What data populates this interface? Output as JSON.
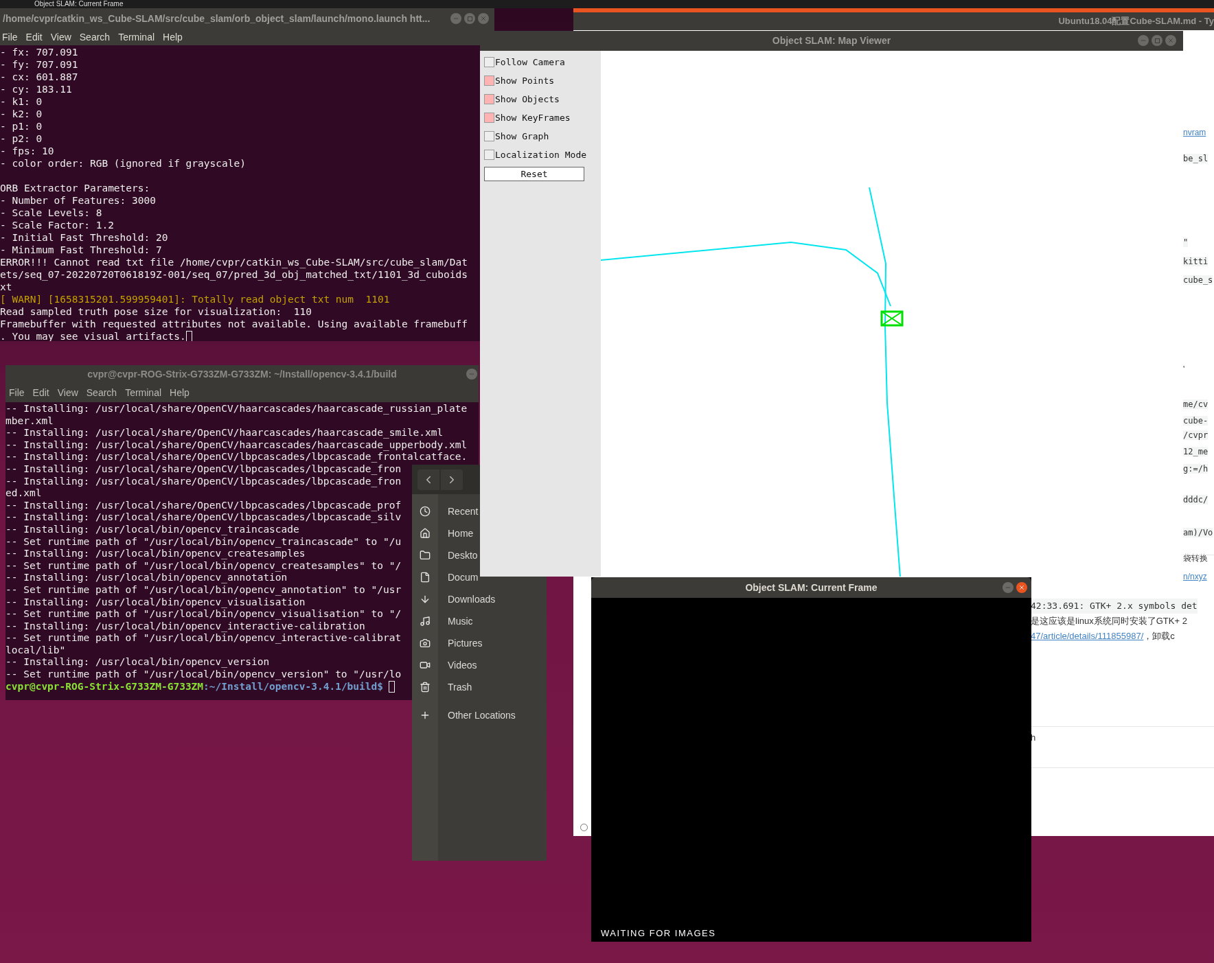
{
  "top_panel": {
    "title": "Object SLAM: Current Frame"
  },
  "browser": {
    "title": "Ubuntu18.04配置Cube-SLAM.md - Ty",
    "side_fragments": [
      {
        "text": "nvram",
        "kind": "link"
      },
      {
        "text": "be_sl",
        "kind": "code"
      },
      {
        "text": "\"",
        "kind": "code"
      },
      {
        "text": "kitti",
        "kind": "code"
      },
      {
        "text": "cube_s",
        "kind": "code"
      },
      {
        "text": "'",
        "kind": "text"
      },
      {
        "text": "me/cv",
        "kind": "code"
      },
      {
        "text": "cube-",
        "kind": "code"
      },
      {
        "text": "/cvpr",
        "kind": "code"
      },
      {
        "text": "12_me",
        "kind": "code"
      },
      {
        "text": "g:=/h",
        "kind": "code"
      },
      {
        "text": "dddc/",
        "kind": "code"
      },
      {
        "text": "am)/Vo",
        "kind": "code"
      },
      {
        "text": "袋转换",
        "kind": "text"
      },
      {
        "text": "n/nxyz",
        "kind": "link"
      }
    ],
    "lower_fragments": [
      {
        "text": "42:33.691: GTK+ 2.x symbols det",
        "kind": "code"
      },
      {
        "text": "是这应该是linux系统同时安装了GTK+ 2",
        "kind": "text"
      },
      {
        "text": "47/article/details/111855987/",
        "kind": "link"
      },
      {
        "text": "，卸载c",
        "kind": "text"
      },
      {
        "text": "h",
        "kind": "text"
      }
    ]
  },
  "terminal_1": {
    "title": "/home/cvpr/catkin_ws_Cube-SLAM/src/cube_slam/orb_object_slam/launch/mono.launch htt...",
    "menu": [
      "File",
      "Edit",
      "View",
      "Search",
      "Terminal",
      "Help"
    ],
    "lines": [
      {
        "text": "- fx: 707.091",
        "kind": "normal"
      },
      {
        "text": "- fy: 707.091",
        "kind": "normal"
      },
      {
        "text": "- cx: 601.887",
        "kind": "normal"
      },
      {
        "text": "- cy: 183.11",
        "kind": "normal"
      },
      {
        "text": "- k1: 0",
        "kind": "normal"
      },
      {
        "text": "- k2: 0",
        "kind": "normal"
      },
      {
        "text": "- p1: 0",
        "kind": "normal"
      },
      {
        "text": "- p2: 0",
        "kind": "normal"
      },
      {
        "text": "- fps: 10",
        "kind": "normal"
      },
      {
        "text": "- color order: RGB (ignored if grayscale)",
        "kind": "normal"
      },
      {
        "kind": "blank"
      },
      {
        "text": "ORB Extractor Parameters:",
        "kind": "normal"
      },
      {
        "text": "- Number of Features: 3000",
        "kind": "normal"
      },
      {
        "text": "- Scale Levels: 8",
        "kind": "normal"
      },
      {
        "text": "- Scale Factor: 1.2",
        "kind": "normal"
      },
      {
        "text": "- Initial Fast Threshold: 20",
        "kind": "normal"
      },
      {
        "text": "- Minimum Fast Threshold: 7",
        "kind": "normal"
      },
      {
        "text": "ERROR!!! Cannot read txt file /home/cvpr/catkin_ws_Cube-SLAM/src/cube_slam/Dat",
        "kind": "normal"
      },
      {
        "text": "ets/seq_07-20220720T061819Z-001/seq_07/pred_3d_obj_matched_txt/1101_3d_cuboids",
        "kind": "normal"
      },
      {
        "text": "xt",
        "kind": "normal"
      },
      {
        "text": "[ WARN] [1658315201.599959401]: Totally read object txt num  1101",
        "kind": "warn"
      },
      {
        "text": "Read sampled truth pose size for visualization:  110",
        "kind": "normal"
      },
      {
        "text": "Framebuffer with requested attributes not available. Using available framebuff",
        "kind": "normal"
      },
      {
        "text": ". You may see visual artifacts.",
        "kind": "cursor"
      }
    ]
  },
  "terminal_2": {
    "title": "cvpr@cvpr-ROG-Strix-G733ZM-G733ZM: ~/Install/opencv-3.4.1/build",
    "menu": [
      "File",
      "Edit",
      "View",
      "Search",
      "Terminal",
      "Help"
    ],
    "lines": [
      "-- Installing: /usr/local/share/OpenCV/haarcascades/haarcascade_russian_plate",
      "mber.xml",
      "-- Installing: /usr/local/share/OpenCV/haarcascades/haarcascade_smile.xml",
      "-- Installing: /usr/local/share/OpenCV/haarcascades/haarcascade_upperbody.xml",
      "-- Installing: /usr/local/share/OpenCV/lbpcascades/lbpcascade_frontalcatface.",
      "-- Installing: /usr/local/share/OpenCV/lbpcascades/lbpcascade_fron",
      "-- Installing: /usr/local/share/OpenCV/lbpcascades/lbpcascade_fron",
      "ed.xml",
      "-- Installing: /usr/local/share/OpenCV/lbpcascades/lbpcascade_prof",
      "-- Installing: /usr/local/share/OpenCV/lbpcascades/lbpcascade_silv",
      "-- Installing: /usr/local/bin/opencv_traincascade",
      "-- Set runtime path of \"/usr/local/bin/opencv_traincascade\" to \"/u",
      "-- Installing: /usr/local/bin/opencv_createsamples",
      "-- Set runtime path of \"/usr/local/bin/opencv_createsamples\" to \"/",
      "-- Installing: /usr/local/bin/opencv_annotation",
      "-- Set runtime path of \"/usr/local/bin/opencv_annotation\" to \"/usr",
      "-- Installing: /usr/local/bin/opencv_visualisation",
      "-- Set runtime path of \"/usr/local/bin/opencv_visualisation\" to \"/",
      "-- Installing: /usr/local/bin/opencv_interactive-calibration",
      "-- Set runtime path of \"/usr/local/bin/opencv_interactive-calibrat",
      "local/lib\"",
      "-- Installing: /usr/local/bin/opencv_version",
      "-- Set runtime path of \"/usr/local/bin/opencv_version\" to \"/usr/lo"
    ],
    "prompt": {
      "user_host": "cvpr@cvpr-ROG-Strix-G733ZM-G733ZM",
      "path": ":~/Install/opencv-3.4.1/build$"
    }
  },
  "file_manager": {
    "places": [
      {
        "label": "Recent",
        "kind": "recent"
      },
      {
        "label": "Home",
        "kind": "home"
      },
      {
        "label": "Deskto",
        "kind": "folder"
      },
      {
        "label": "Docum",
        "kind": "document"
      },
      {
        "label": "Downloads",
        "kind": "download"
      },
      {
        "label": "Music",
        "kind": "music"
      },
      {
        "label": "Pictures",
        "kind": "camera"
      },
      {
        "label": "Videos",
        "kind": "video"
      },
      {
        "label": "Trash",
        "kind": "trash"
      },
      {
        "label": "Other Locations",
        "kind": "plus"
      }
    ]
  },
  "map_viewer": {
    "title": "Object SLAM: Map Viewer",
    "options": [
      {
        "label": "Follow Camera",
        "checked": false
      },
      {
        "label": "Show Points",
        "checked": true
      },
      {
        "label": "Show Objects",
        "checked": true
      },
      {
        "label": "Show KeyFrames",
        "checked": true
      },
      {
        "label": "Show Graph",
        "checked": false
      },
      {
        "label": "Localization Mode",
        "checked": false
      }
    ],
    "reset_label": "Reset"
  },
  "current_frame": {
    "title": "Object SLAM: Current Frame",
    "status": "WAITING FOR IMAGES"
  }
}
